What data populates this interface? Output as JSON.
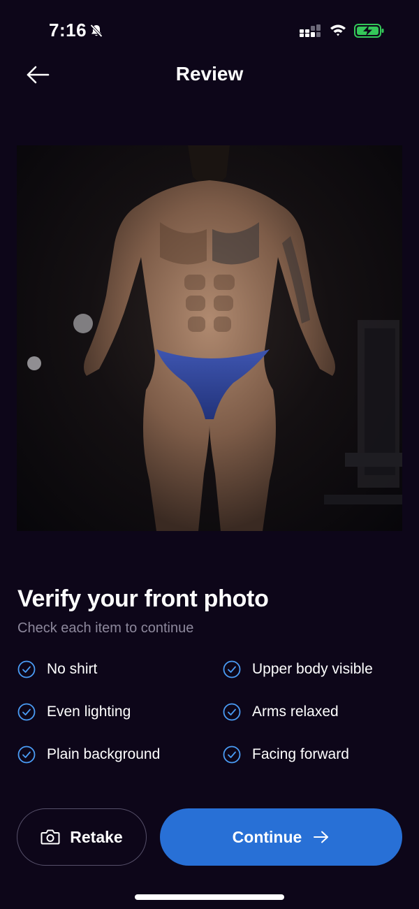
{
  "status_bar": {
    "time": "7:16",
    "icons": [
      "bell-off-icon",
      "signal-icon",
      "wifi-icon",
      "battery-charging-icon"
    ],
    "battery_color": "#34c759"
  },
  "nav": {
    "back_icon": "arrow-left-icon",
    "title": "Review"
  },
  "photo": {
    "subject": "front photo"
  },
  "verify": {
    "title": "Verify your front photo",
    "subtitle": "Check each item to continue"
  },
  "checklist": [
    {
      "label": "No shirt",
      "checked": true
    },
    {
      "label": "Upper body visible",
      "checked": true
    },
    {
      "label": "Even lighting",
      "checked": true
    },
    {
      "label": "Arms relaxed",
      "checked": true
    },
    {
      "label": "Plain background",
      "checked": true
    },
    {
      "label": "Facing forward",
      "checked": true
    }
  ],
  "buttons": {
    "retake_label": "Retake",
    "retake_icon": "camera-icon",
    "continue_label": "Continue",
    "continue_icon": "arrow-right-icon"
  },
  "colors": {
    "background": "#0d0619",
    "accent": "#2870d6",
    "check": "#4a9cf5",
    "muted_text": "#8d889c"
  }
}
